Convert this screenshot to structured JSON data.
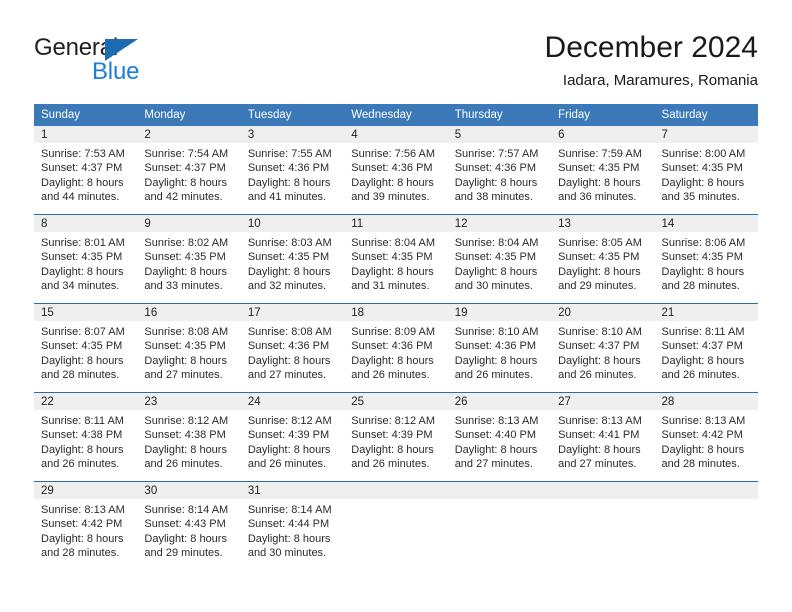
{
  "brand": {
    "general": "General",
    "blue": "Blue",
    "triangle_color": "#1b6cb2",
    "blue_color": "#1b7fd4"
  },
  "header": {
    "month_title": "December 2024",
    "location": "Iadara, Maramures, Romania"
  },
  "calendar": {
    "header_bg": "#3b79b8",
    "header_text_color": "#ffffff",
    "daynum_band_bg": "#efefef",
    "row_border_color": "#2e6ba8",
    "weekdays": [
      "Sunday",
      "Monday",
      "Tuesday",
      "Wednesday",
      "Thursday",
      "Friday",
      "Saturday"
    ],
    "weeks": [
      [
        {
          "day": "1",
          "sunrise": "Sunrise: 7:53 AM",
          "sunset": "Sunset: 4:37 PM",
          "daylight_line1": "Daylight: 8 hours",
          "daylight_line2": "and 44 minutes."
        },
        {
          "day": "2",
          "sunrise": "Sunrise: 7:54 AM",
          "sunset": "Sunset: 4:37 PM",
          "daylight_line1": "Daylight: 8 hours",
          "daylight_line2": "and 42 minutes."
        },
        {
          "day": "3",
          "sunrise": "Sunrise: 7:55 AM",
          "sunset": "Sunset: 4:36 PM",
          "daylight_line1": "Daylight: 8 hours",
          "daylight_line2": "and 41 minutes."
        },
        {
          "day": "4",
          "sunrise": "Sunrise: 7:56 AM",
          "sunset": "Sunset: 4:36 PM",
          "daylight_line1": "Daylight: 8 hours",
          "daylight_line2": "and 39 minutes."
        },
        {
          "day": "5",
          "sunrise": "Sunrise: 7:57 AM",
          "sunset": "Sunset: 4:36 PM",
          "daylight_line1": "Daylight: 8 hours",
          "daylight_line2": "and 38 minutes."
        },
        {
          "day": "6",
          "sunrise": "Sunrise: 7:59 AM",
          "sunset": "Sunset: 4:35 PM",
          "daylight_line1": "Daylight: 8 hours",
          "daylight_line2": "and 36 minutes."
        },
        {
          "day": "7",
          "sunrise": "Sunrise: 8:00 AM",
          "sunset": "Sunset: 4:35 PM",
          "daylight_line1": "Daylight: 8 hours",
          "daylight_line2": "and 35 minutes."
        }
      ],
      [
        {
          "day": "8",
          "sunrise": "Sunrise: 8:01 AM",
          "sunset": "Sunset: 4:35 PM",
          "daylight_line1": "Daylight: 8 hours",
          "daylight_line2": "and 34 minutes."
        },
        {
          "day": "9",
          "sunrise": "Sunrise: 8:02 AM",
          "sunset": "Sunset: 4:35 PM",
          "daylight_line1": "Daylight: 8 hours",
          "daylight_line2": "and 33 minutes."
        },
        {
          "day": "10",
          "sunrise": "Sunrise: 8:03 AM",
          "sunset": "Sunset: 4:35 PM",
          "daylight_line1": "Daylight: 8 hours",
          "daylight_line2": "and 32 minutes."
        },
        {
          "day": "11",
          "sunrise": "Sunrise: 8:04 AM",
          "sunset": "Sunset: 4:35 PM",
          "daylight_line1": "Daylight: 8 hours",
          "daylight_line2": "and 31 minutes."
        },
        {
          "day": "12",
          "sunrise": "Sunrise: 8:04 AM",
          "sunset": "Sunset: 4:35 PM",
          "daylight_line1": "Daylight: 8 hours",
          "daylight_line2": "and 30 minutes."
        },
        {
          "day": "13",
          "sunrise": "Sunrise: 8:05 AM",
          "sunset": "Sunset: 4:35 PM",
          "daylight_line1": "Daylight: 8 hours",
          "daylight_line2": "and 29 minutes."
        },
        {
          "day": "14",
          "sunrise": "Sunrise: 8:06 AM",
          "sunset": "Sunset: 4:35 PM",
          "daylight_line1": "Daylight: 8 hours",
          "daylight_line2": "and 28 minutes."
        }
      ],
      [
        {
          "day": "15",
          "sunrise": "Sunrise: 8:07 AM",
          "sunset": "Sunset: 4:35 PM",
          "daylight_line1": "Daylight: 8 hours",
          "daylight_line2": "and 28 minutes."
        },
        {
          "day": "16",
          "sunrise": "Sunrise: 8:08 AM",
          "sunset": "Sunset: 4:35 PM",
          "daylight_line1": "Daylight: 8 hours",
          "daylight_line2": "and 27 minutes."
        },
        {
          "day": "17",
          "sunrise": "Sunrise: 8:08 AM",
          "sunset": "Sunset: 4:36 PM",
          "daylight_line1": "Daylight: 8 hours",
          "daylight_line2": "and 27 minutes."
        },
        {
          "day": "18",
          "sunrise": "Sunrise: 8:09 AM",
          "sunset": "Sunset: 4:36 PM",
          "daylight_line1": "Daylight: 8 hours",
          "daylight_line2": "and 26 minutes."
        },
        {
          "day": "19",
          "sunrise": "Sunrise: 8:10 AM",
          "sunset": "Sunset: 4:36 PM",
          "daylight_line1": "Daylight: 8 hours",
          "daylight_line2": "and 26 minutes."
        },
        {
          "day": "20",
          "sunrise": "Sunrise: 8:10 AM",
          "sunset": "Sunset: 4:37 PM",
          "daylight_line1": "Daylight: 8 hours",
          "daylight_line2": "and 26 minutes."
        },
        {
          "day": "21",
          "sunrise": "Sunrise: 8:11 AM",
          "sunset": "Sunset: 4:37 PM",
          "daylight_line1": "Daylight: 8 hours",
          "daylight_line2": "and 26 minutes."
        }
      ],
      [
        {
          "day": "22",
          "sunrise": "Sunrise: 8:11 AM",
          "sunset": "Sunset: 4:38 PM",
          "daylight_line1": "Daylight: 8 hours",
          "daylight_line2": "and 26 minutes."
        },
        {
          "day": "23",
          "sunrise": "Sunrise: 8:12 AM",
          "sunset": "Sunset: 4:38 PM",
          "daylight_line1": "Daylight: 8 hours",
          "daylight_line2": "and 26 minutes."
        },
        {
          "day": "24",
          "sunrise": "Sunrise: 8:12 AM",
          "sunset": "Sunset: 4:39 PM",
          "daylight_line1": "Daylight: 8 hours",
          "daylight_line2": "and 26 minutes."
        },
        {
          "day": "25",
          "sunrise": "Sunrise: 8:12 AM",
          "sunset": "Sunset: 4:39 PM",
          "daylight_line1": "Daylight: 8 hours",
          "daylight_line2": "and 26 minutes."
        },
        {
          "day": "26",
          "sunrise": "Sunrise: 8:13 AM",
          "sunset": "Sunset: 4:40 PM",
          "daylight_line1": "Daylight: 8 hours",
          "daylight_line2": "and 27 minutes."
        },
        {
          "day": "27",
          "sunrise": "Sunrise: 8:13 AM",
          "sunset": "Sunset: 4:41 PM",
          "daylight_line1": "Daylight: 8 hours",
          "daylight_line2": "and 27 minutes."
        },
        {
          "day": "28",
          "sunrise": "Sunrise: 8:13 AM",
          "sunset": "Sunset: 4:42 PM",
          "daylight_line1": "Daylight: 8 hours",
          "daylight_line2": "and 28 minutes."
        }
      ],
      [
        {
          "day": "29",
          "sunrise": "Sunrise: 8:13 AM",
          "sunset": "Sunset: 4:42 PM",
          "daylight_line1": "Daylight: 8 hours",
          "daylight_line2": "and 28 minutes."
        },
        {
          "day": "30",
          "sunrise": "Sunrise: 8:14 AM",
          "sunset": "Sunset: 4:43 PM",
          "daylight_line1": "Daylight: 8 hours",
          "daylight_line2": "and 29 minutes."
        },
        {
          "day": "31",
          "sunrise": "Sunrise: 8:14 AM",
          "sunset": "Sunset: 4:44 PM",
          "daylight_line1": "Daylight: 8 hours",
          "daylight_line2": "and 30 minutes."
        },
        {
          "day": "",
          "sunrise": "",
          "sunset": "",
          "daylight_line1": "",
          "daylight_line2": ""
        },
        {
          "day": "",
          "sunrise": "",
          "sunset": "",
          "daylight_line1": "",
          "daylight_line2": ""
        },
        {
          "day": "",
          "sunrise": "",
          "sunset": "",
          "daylight_line1": "",
          "daylight_line2": ""
        },
        {
          "day": "",
          "sunrise": "",
          "sunset": "",
          "daylight_line1": "",
          "daylight_line2": ""
        }
      ]
    ]
  }
}
